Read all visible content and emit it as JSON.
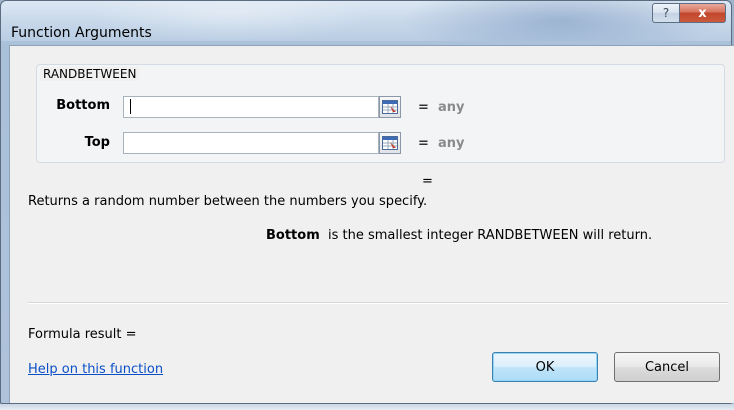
{
  "window": {
    "title": "Function Arguments",
    "help_glyph": "?",
    "close_glyph": "x"
  },
  "function_group": {
    "name": "RANDBETWEEN",
    "args": [
      {
        "label": "Bottom",
        "value": "",
        "equals": "=",
        "result": "any"
      },
      {
        "label": "Top",
        "value": "",
        "equals": "=",
        "result": "any"
      }
    ],
    "ref_icon": "range-select-icon"
  },
  "result_equals": "=",
  "description": "Returns a random number between the numbers you specify.",
  "arg_help": {
    "arg_name": "Bottom",
    "text": "is the smallest integer RANDBETWEEN will return."
  },
  "formula_result": "Formula result =",
  "help_link": "Help on this function",
  "buttons": {
    "ok": "OK",
    "cancel": "Cancel"
  },
  "colors": {
    "link": "#0b4fc7",
    "close_button": "#c2462b",
    "ok_highlight": "#acdcf7"
  }
}
